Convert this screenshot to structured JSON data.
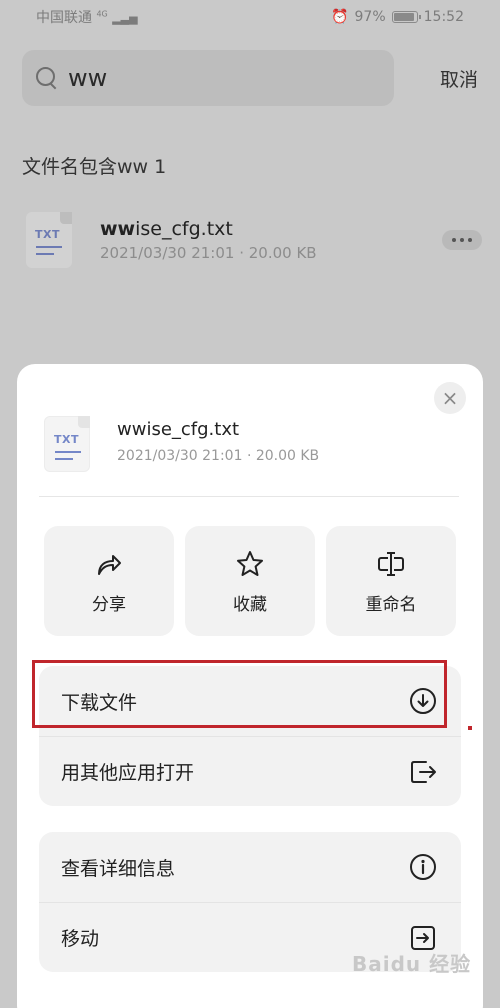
{
  "status_bar": {
    "carrier": "中国联通",
    "network": "4G",
    "battery": "97%",
    "battery_level": 0.97,
    "time": "15:52"
  },
  "search": {
    "query": "ww",
    "cancel_label": "取消"
  },
  "results": {
    "section_label": "文件名包含ww 1",
    "items": [
      {
        "name_match": "ww",
        "name_rest": "ise_cfg.txt",
        "meta": "2021/03/30 21:01 · 20.00 KB",
        "icon_text": "TXT"
      }
    ]
  },
  "sheet": {
    "file_name": "wwise_cfg.txt",
    "file_meta": "2021/03/30 21:01 · 20.00 KB",
    "icon_text": "TXT",
    "close_glyph": "×",
    "actions": [
      {
        "label": "分享",
        "icon": "share-icon"
      },
      {
        "label": "收藏",
        "icon": "star-icon"
      },
      {
        "label": "重命名",
        "icon": "rename-icon"
      }
    ],
    "group1": [
      {
        "label": "下载文件",
        "icon": "download-icon"
      },
      {
        "label": "用其他应用打开",
        "icon": "open-with-icon"
      }
    ],
    "group2": [
      {
        "label": "查看详细信息",
        "icon": "info-icon"
      },
      {
        "label": "移动",
        "icon": "move-icon"
      }
    ]
  },
  "colors": {
    "highlight": "#c0262c",
    "icon_accent": "#7487c8"
  },
  "watermark": "Baidu 经验"
}
